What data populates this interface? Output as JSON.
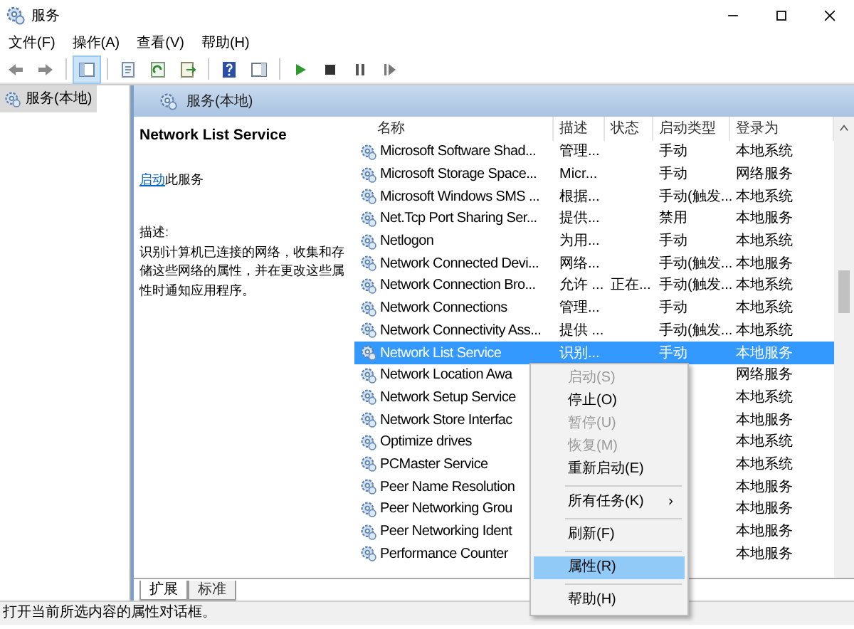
{
  "window": {
    "title": "服务"
  },
  "menu_bar": [
    "文件(F)",
    "操作(A)",
    "查看(V)",
    "帮助(H)"
  ],
  "tree": [
    {
      "label": "服务(本地)",
      "selected": true
    }
  ],
  "pane_header": "服务(本地)",
  "details": {
    "service_name": "Network List Service",
    "start_link": "启动",
    "start_text": "此服务",
    "description_label": "描述:",
    "description": "识别计算机已连接的网络，收集和存储这些网络的属性，并在更改这些属性时通知应用程序。"
  },
  "table": {
    "columns": [
      "名称",
      "描述",
      "状态",
      "启动类型",
      "登录为"
    ],
    "rows": [
      {
        "name": "Microsoft Software Shad...",
        "description": "管理...",
        "startup_type": "手动",
        "log_on_as": "本地系统",
        "selected": false
      },
      {
        "name": "Microsoft Storage Space...",
        "description": "Micr...",
        "startup_type": "手动",
        "log_on_as": "网络服务",
        "selected": false
      },
      {
        "name": "Microsoft Windows SMS ...",
        "description": "根据...",
        "startup_type": "手动(触发...",
        "log_on_as": "本地系统",
        "selected": false
      },
      {
        "name": "Net.Tcp Port Sharing Ser...",
        "description": "提供...",
        "startup_type": "禁用",
        "log_on_as": "本地服务",
        "selected": false
      },
      {
        "name": "Netlogon",
        "description": "为用...",
        "startup_type": "手动",
        "log_on_as": "本地系统",
        "selected": false
      },
      {
        "name": "Network Connected Devi...",
        "description": "网络...",
        "startup_type": "手动(触发...",
        "log_on_as": "本地服务",
        "selected": false
      },
      {
        "name": "Network Connection Bro...",
        "description": "允许 ...",
        "status": "正在...",
        "startup_type": "手动(触发...",
        "log_on_as": "本地系统",
        "selected": false
      },
      {
        "name": "Network Connections",
        "description": "管理...",
        "startup_type": "手动",
        "log_on_as": "本地系统",
        "selected": false
      },
      {
        "name": "Network Connectivity Ass...",
        "description": "提供 ...",
        "startup_type": "手动(触发...",
        "log_on_as": "本地系统",
        "selected": false
      },
      {
        "name": "Network List Service",
        "description": "识别...",
        "startup_type": "手动",
        "log_on_as": "本地服务",
        "selected": true
      },
      {
        "name": "Network Location Awa",
        "log_on_as": "网络服务",
        "selected": false
      },
      {
        "name": "Network Setup Service",
        "log_on_as": "本地系统",
        "selected": false
      },
      {
        "name": "Network Store Interfac",
        "log_on_as": "本地服务",
        "selected": false
      },
      {
        "name": "Optimize drives",
        "log_on_as": "本地系统",
        "selected": false
      },
      {
        "name": "PCMaster Service",
        "log_on_as": "本地系统",
        "selected": false
      },
      {
        "name": "Peer Name Resolution",
        "log_on_as": "本地服务",
        "selected": false
      },
      {
        "name": "Peer Networking Grou",
        "log_on_as": "本地服务",
        "selected": false
      },
      {
        "name": "Peer Networking Ident",
        "log_on_as": "本地服务",
        "selected": false
      },
      {
        "name": "Performance Counter",
        "log_on_as": "本地服务",
        "selected": false
      }
    ]
  },
  "context_menu": [
    {
      "kind": "item",
      "label": "启动(S)",
      "disabled": true,
      "selected": false
    },
    {
      "kind": "item",
      "label": "停止(O)",
      "disabled": false,
      "selected": false
    },
    {
      "kind": "item",
      "label": "暂停(U)",
      "disabled": true,
      "selected": false
    },
    {
      "kind": "item",
      "label": "恢复(M)",
      "disabled": true,
      "selected": false
    },
    {
      "kind": "item",
      "label": "重新启动(E)",
      "disabled": false,
      "selected": false
    },
    {
      "kind": "separator"
    },
    {
      "kind": "submenu",
      "label": "所有任务(K)",
      "arrow": "›",
      "disabled": false,
      "selected": false
    },
    {
      "kind": "separator"
    },
    {
      "kind": "item",
      "label": "刷新(F)",
      "disabled": false,
      "selected": false
    },
    {
      "kind": "separator"
    },
    {
      "kind": "item",
      "label": "属性(R)",
      "disabled": false,
      "selected": true
    },
    {
      "kind": "separator"
    },
    {
      "kind": "item",
      "label": "帮助(H)",
      "disabled": false,
      "selected": false
    }
  ],
  "tabs": [
    {
      "label": "扩展",
      "selected": true
    },
    {
      "label": "标准",
      "selected": false
    }
  ],
  "status_bar": "打开当前所选内容的属性对话框。"
}
